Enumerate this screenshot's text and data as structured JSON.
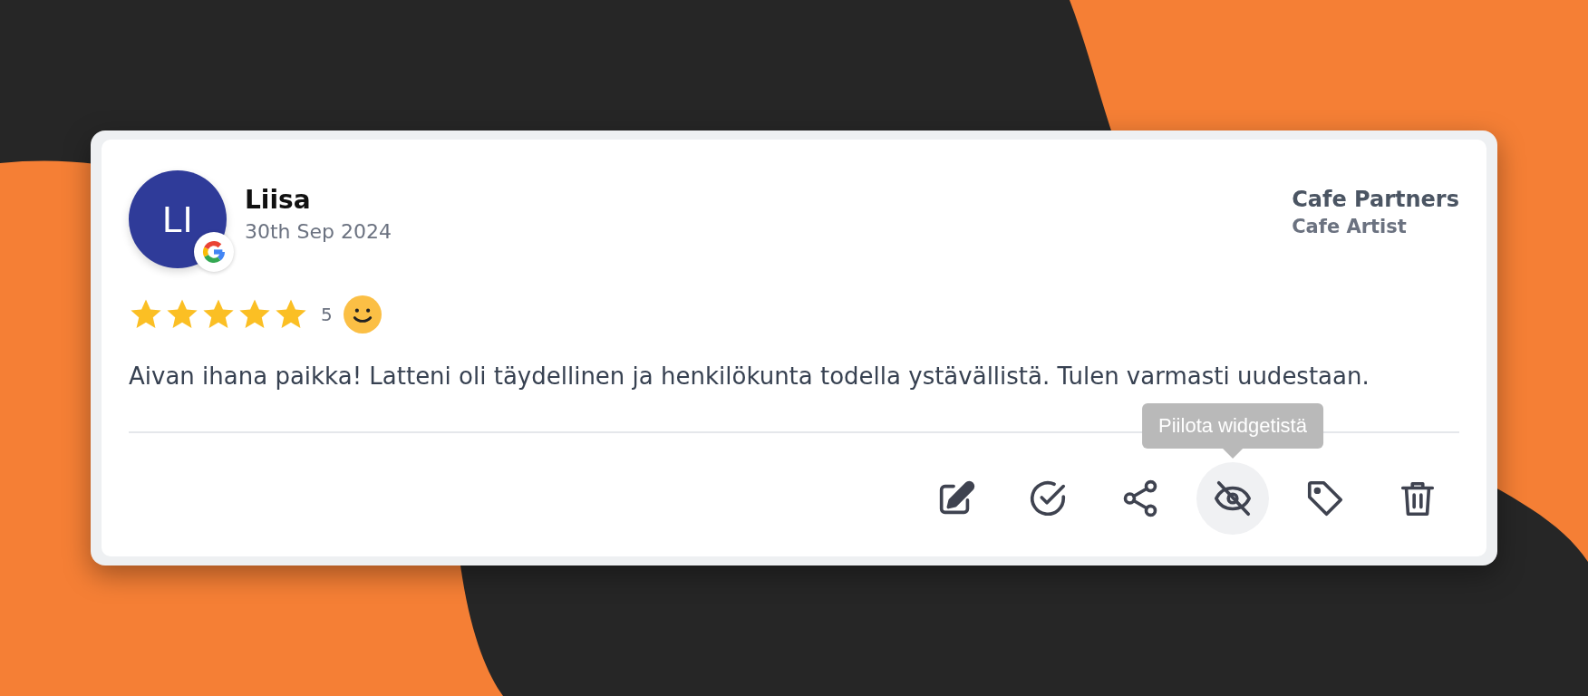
{
  "review": {
    "avatar_initials": "LI",
    "source": {
      "kind": "google"
    },
    "name": "Liisa",
    "date": "30th Sep 2024",
    "company": "Cafe Partners",
    "location": "Cafe Artist",
    "rating": {
      "stars": 5,
      "value": "5",
      "mood": {
        "kind": "happy"
      }
    },
    "text": "Aivan ihana paikka! Latteni oli täydellinen ja henkilökunta todella ystävällistä. Tulen varmasti uudestaan."
  },
  "actions": [
    {
      "kind": "edit",
      "hovered": false
    },
    {
      "kind": "approve",
      "hovered": false
    },
    {
      "kind": "share",
      "hovered": false
    },
    {
      "kind": "hide",
      "hovered": true,
      "tooltip": "Piilota widgetistä"
    },
    {
      "kind": "tag",
      "hovered": false
    },
    {
      "kind": "delete",
      "hovered": false
    }
  ]
}
